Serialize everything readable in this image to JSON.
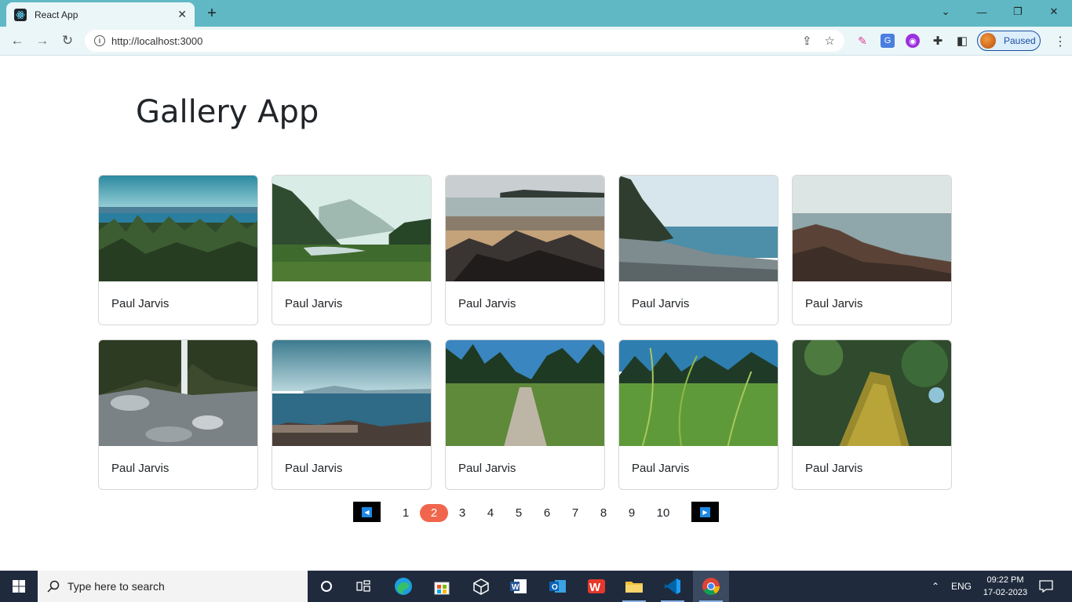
{
  "browser": {
    "tab_title": "React App",
    "url": "http://localhost:3000",
    "profile_status": "Paused"
  },
  "page": {
    "title": "Gallery App"
  },
  "gallery": {
    "cards": [
      {
        "author": "Paul Jarvis",
        "scene": "forest-lake-view"
      },
      {
        "author": "Paul Jarvis",
        "scene": "misty-valley-meadow"
      },
      {
        "author": "Paul Jarvis",
        "scene": "beach-rocks"
      },
      {
        "author": "Paul Jarvis",
        "scene": "pebble-shore"
      },
      {
        "author": "Paul Jarvis",
        "scene": "rocky-coast"
      },
      {
        "author": "Paul Jarvis",
        "scene": "waterfall-creek"
      },
      {
        "author": "Paul Jarvis",
        "scene": "driftwood-shore"
      },
      {
        "author": "Paul Jarvis",
        "scene": "forest-path"
      },
      {
        "author": "Paul Jarvis",
        "scene": "grass-closeup"
      },
      {
        "author": "Paul Jarvis",
        "scene": "mossy-trunk"
      }
    ]
  },
  "pagination": {
    "pages": [
      "1",
      "2",
      "3",
      "4",
      "5",
      "6",
      "7",
      "8",
      "9",
      "10"
    ],
    "current": "2"
  },
  "taskbar": {
    "search_placeholder": "Type here to search",
    "language": "ENG",
    "time": "09:22 PM",
    "date": "17-02-2023"
  },
  "colors": {
    "titlebar": "#5fb8c4",
    "active_page": "#f0664d",
    "pagination_arrow": "#1e88e5"
  }
}
